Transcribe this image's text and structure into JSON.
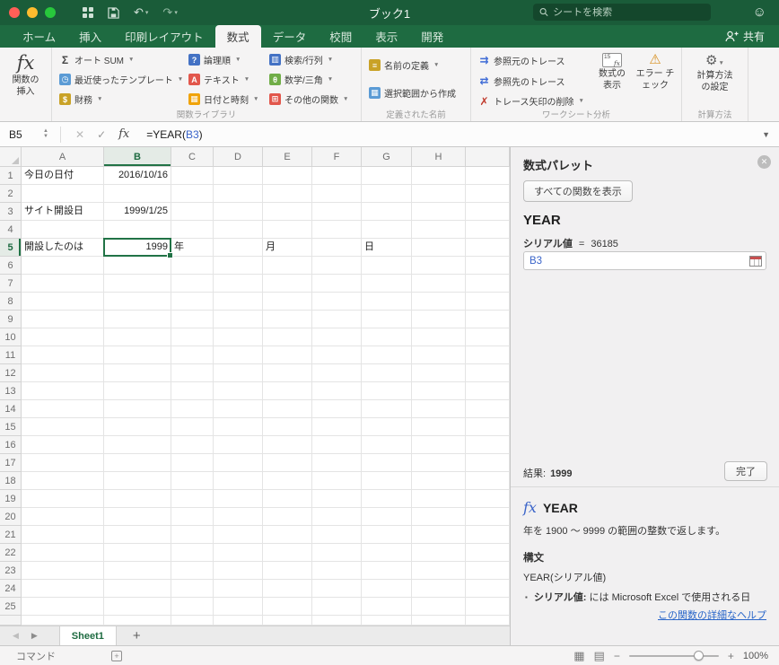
{
  "titlebar": {
    "title": "ブック1",
    "search_placeholder": "シートを検索"
  },
  "active_tab": "数式",
  "ribbon_tabs": [
    {
      "label": "ホーム"
    },
    {
      "label": "挿入"
    },
    {
      "label": "印刷レイアウト"
    },
    {
      "label": "数式"
    },
    {
      "label": "データ"
    },
    {
      "label": "校閲"
    },
    {
      "label": "表示"
    },
    {
      "label": "開発"
    }
  ],
  "share_label": "共有",
  "ribbon": {
    "fx_glyph": "fx",
    "insert_function_label": "関数の挿入",
    "library_caption": "関数ライブラリ",
    "library": [
      {
        "name": "autosum-button",
        "icon": "autosum-sigma-icon",
        "label": "オート SUM",
        "glyph": "Σ",
        "color": null,
        "glyph_color": "#454545",
        "caret": true
      },
      {
        "name": "recently-used-button",
        "icon": "recent-clock-icon",
        "label": "最近使ったテンプレート",
        "glyph": "◷",
        "color": "#5b9bd5",
        "glyph_color": "#ffffff",
        "caret": true
      },
      {
        "name": "financial-button",
        "icon": "financial-coins-icon",
        "label": "財務",
        "glyph": "$",
        "color": "#c9a227",
        "glyph_color": "#ffffff",
        "caret": true
      },
      {
        "name": "logical-button",
        "icon": "logical-question-icon",
        "label": "論理順",
        "glyph": "?",
        "color": "#4472c4",
        "glyph_color": "#ffffff",
        "caret": true
      },
      {
        "name": "text-button",
        "icon": "text-a-icon",
        "label": "テキスト",
        "glyph": "A",
        "color": "#e2574c",
        "glyph_color": "#ffffff",
        "caret": true
      },
      {
        "name": "datetime-button",
        "icon": "calendar-icon",
        "label": "日付と時刻",
        "glyph": "▦",
        "color": "#f0a30a",
        "glyph_color": "#ffffff",
        "caret": true
      },
      {
        "name": "lookup-button",
        "icon": "lookup-grid-icon",
        "label": "検索/行列",
        "glyph": "▥",
        "color": "#4472c4",
        "glyph_color": "#ffffff",
        "caret": true
      },
      {
        "name": "math-button",
        "icon": "math-theta-icon",
        "label": "数学/三角",
        "glyph": "θ",
        "color": "#70ad47",
        "glyph_color": "#ffffff",
        "caret": true
      },
      {
        "name": "more-functions-button",
        "icon": "more-functions-grid-icon",
        "label": "その他の関数",
        "glyph": "⊞",
        "color": "#e2574c",
        "glyph_color": "#ffffff",
        "caret": true
      }
    ],
    "names_caption": "定義された名前",
    "names": [
      {
        "name": "define-name-button",
        "icon": "name-tag-icon",
        "label": "名前の定義",
        "glyph": "≡",
        "color": "#c9a227",
        "glyph_color": "#ffffff",
        "caret": true
      },
      {
        "name": "create-from-selection-button",
        "icon": "create-from-selection-icon",
        "label": "選択範囲から作成",
        "glyph": "▦",
        "color": "#5b9bd5",
        "glyph_color": "#ffffff",
        "caret": false
      }
    ],
    "audit_caption": "ワークシート分析",
    "audit": [
      {
        "name": "trace-precedents-button",
        "icon": "trace-precedents-icon",
        "label": "参照元のトレース",
        "glyph": "⇉",
        "color": null,
        "glyph_color": "#3f6bd6",
        "caret": false
      },
      {
        "name": "trace-dependents-button",
        "icon": "trace-dependents-icon",
        "label": "参照先のトレース",
        "glyph": "⇄",
        "color": null,
        "glyph_color": "#3f6bd6",
        "caret": false
      },
      {
        "name": "remove-arrows-button",
        "icon": "remove-arrows-icon",
        "label": "トレース矢印の削除",
        "glyph": "✗",
        "color": null,
        "glyph_color": "#c0392b",
        "caret": true
      }
    ],
    "show_formulas_label": "数式の表示",
    "show_formulas_icon": {
      "num": "15",
      "fx": "fx"
    },
    "error_check_label": "エラー チェック",
    "calc_options_label": "計算方法の設定",
    "calc_caption": "計算方法"
  },
  "formula_bar": {
    "name_box": "B5",
    "cancel_glyph": "✕",
    "enter_glyph": "✓",
    "fx_glyph": "fx",
    "formula_prefix": "=YEAR(",
    "formula_ref": "B3",
    "formula_suffix": ")"
  },
  "grid": {
    "columns": [
      "A",
      "B",
      "C",
      "D",
      "E",
      "F",
      "G",
      "H"
    ],
    "rows": 25,
    "selected_cell": "B5",
    "cells": [
      {
        "ref": "A1",
        "text": "今日の日付",
        "align": "left"
      },
      {
        "ref": "B1",
        "text": "2016/10/16",
        "align": "right"
      },
      {
        "ref": "A3",
        "text": "サイト開設日",
        "align": "left"
      },
      {
        "ref": "B3",
        "text": "1999/1/25",
        "align": "right"
      },
      {
        "ref": "A5",
        "text": "開設したのは",
        "align": "left"
      },
      {
        "ref": "B5",
        "text": "1999",
        "align": "right"
      },
      {
        "ref": "C5",
        "text": "年",
        "align": "left"
      },
      {
        "ref": "E5",
        "text": "月",
        "align": "left"
      },
      {
        "ref": "G5",
        "text": "日",
        "align": "left"
      }
    ]
  },
  "panel": {
    "title": "数式パレット",
    "show_all_button": "すべての関数を表示",
    "function_name": "YEAR",
    "arg_name": "シリアル値",
    "arg_equals": "=",
    "arg_value": "36185",
    "input_value": "B3",
    "result_label": "結果:",
    "result_value": "1999",
    "done_button": "完了",
    "help_fx": "fx",
    "help_title": "YEAR",
    "help_description": "年を 1900 〜 9999 の範囲の整数で返します。",
    "syntax_label": "構文",
    "syntax_text": "YEAR(シリアル値)",
    "bullet_term": "シリアル値:",
    "bullet_rest": "には Microsoft Excel で使用される日",
    "help_link": "この関数の詳細なヘルプ"
  },
  "sheet_bar": {
    "tab": "Sheet1",
    "add": "+"
  },
  "status_bar": {
    "mode": "コマンド",
    "zoom": "100%"
  }
}
